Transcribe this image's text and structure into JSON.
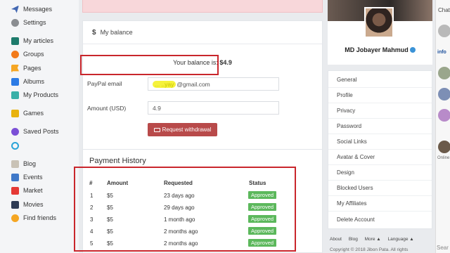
{
  "sidebar": {
    "items": [
      {
        "label": "Messages",
        "color": "#4267b2"
      },
      {
        "label": "Settings",
        "color": "#8a8d91"
      },
      {
        "label": "My articles",
        "color": "#1d7b6c"
      },
      {
        "label": "Groups",
        "color": "#f27a1a"
      },
      {
        "label": "Pages",
        "color": "#f5a623"
      },
      {
        "label": "Albums",
        "color": "#2c7be5"
      },
      {
        "label": "My Products",
        "color": "#39b0a8"
      },
      {
        "label": "Games",
        "color": "#e8b20e"
      },
      {
        "label": "Saved Posts",
        "color": "#7b4fd6"
      },
      {
        "label": "",
        "color": "#2aa4d8"
      },
      {
        "label": "Blog",
        "color": "#c9c2b6"
      },
      {
        "label": "Events",
        "color": "#3f78c8"
      },
      {
        "label": "Market",
        "color": "#e53935"
      },
      {
        "label": "Movies",
        "color": "#2e3b55"
      },
      {
        "label": "Find friends",
        "color": "#f5a623"
      }
    ]
  },
  "balance": {
    "header": "My balance",
    "header_icon": "dollar-icon",
    "balance_prefix": "Your balance is: ",
    "balance_value": "$4.9",
    "paypal_label": "PayPal email",
    "paypal_value_hidden": "...   ..yay",
    "paypal_value_domain": "@gmail.com",
    "amount_label": "Amount (USD)",
    "amount_value": "4.9",
    "withdraw_button": "Request withdrawal",
    "accent_color": "#b84a4a"
  },
  "history": {
    "title": "Payment History",
    "columns": [
      "#",
      "Amount",
      "Requested",
      "Status"
    ],
    "rows": [
      {
        "id": "1",
        "amount": "$5",
        "requested": "23 days ago",
        "status": "Approved"
      },
      {
        "id": "2",
        "amount": "$5",
        "requested": "29 days ago",
        "status": "Approved"
      },
      {
        "id": "3",
        "amount": "$5",
        "requested": "1 month ago",
        "status": "Approved"
      },
      {
        "id": "4",
        "amount": "$5",
        "requested": "2 months ago",
        "status": "Approved"
      },
      {
        "id": "5",
        "amount": "$5",
        "requested": "2 months ago",
        "status": "Approved"
      }
    ],
    "status_color": "#5cb85c"
  },
  "profile": {
    "name": "MD Jobayer Mahmud",
    "verified_icon": "verified-badge-icon"
  },
  "settings_menu": [
    "General",
    "Profile",
    "Privacy",
    "Password",
    "Social Links",
    "Avatar & Cover",
    "Design",
    "Blocked Users",
    "My Affiliates",
    "Delete Account"
  ],
  "footer": {
    "links": [
      "About",
      "Blog",
      "More ▲",
      "Language ▲"
    ],
    "copyright": "Copyright © 2018 Jibon Pata. All rights"
  },
  "chat": {
    "title": "Chat",
    "online_label": "Online",
    "search_placeholder": "Sear",
    "info_label": "info"
  }
}
